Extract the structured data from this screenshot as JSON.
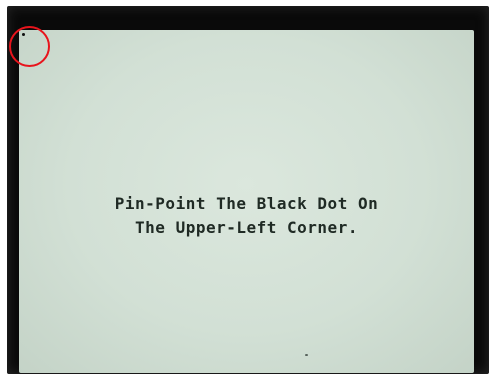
{
  "calibration": {
    "line1": "Pin-Point The Black Dot On",
    "line2": "The Upper-Left Corner."
  },
  "colors": {
    "bezel": "#0a0a0a",
    "screen": "#d2e0d5",
    "text": "#1f2a24",
    "highlight": "#e8141c"
  }
}
